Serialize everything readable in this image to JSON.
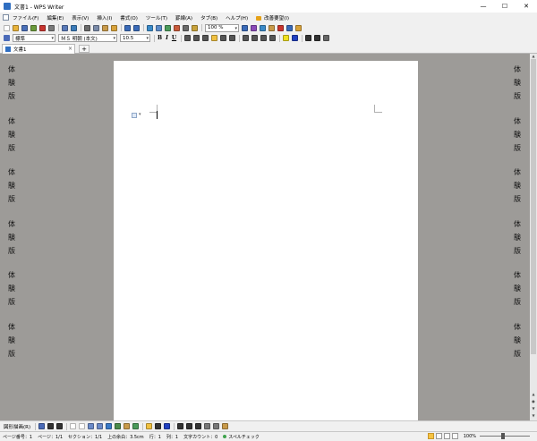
{
  "window": {
    "title": "文書1 - WPS Writer",
    "minimize": "—",
    "maximize": "☐",
    "close": "✕"
  },
  "menu": [
    "ファイル(F)",
    "編集(E)",
    "表示(V)",
    "挿入(I)",
    "書式(O)",
    "ツール(T)",
    "罫線(A)",
    "タブ(B)",
    "ヘルプ(H)",
    "改善要望(I)"
  ],
  "toolbar": {
    "zoom_value": "100 %",
    "style_value": "標準",
    "font_value": "ＭＳ 明朝 (本文)",
    "size_value": "10.5",
    "bold": "B",
    "italic": "I",
    "underline": "U",
    "icons1": [
      {
        "name": "new-icon",
        "color": "#ffffff"
      },
      {
        "name": "open-icon",
        "color": "#e8b23a"
      },
      {
        "name": "save-icon",
        "color": "#4a6fb8"
      },
      {
        "name": "email-icon",
        "color": "#6a9a3a"
      },
      {
        "name": "pdf-icon",
        "color": "#c8342e"
      },
      {
        "name": "print-icon",
        "color": "#7a7a7a"
      },
      {
        "name": "print-preview-icon",
        "color": "#5a7ab8"
      },
      {
        "name": "spellcheck-icon",
        "color": "#3a7ab8"
      },
      {
        "name": "cut-icon",
        "color": "#6a6a6a"
      },
      {
        "name": "copy-icon",
        "color": "#7a8aa8"
      },
      {
        "name": "paste-icon",
        "color": "#c89a4a"
      },
      {
        "name": "format-painter-icon",
        "color": "#d8a23a"
      },
      {
        "name": "undo-icon",
        "color": "#3a6ab8"
      },
      {
        "name": "redo-icon",
        "color": "#3a6ab8"
      },
      {
        "name": "hyperlink-icon",
        "color": "#3a8ac8"
      },
      {
        "name": "table-icon",
        "color": "#5a8ac8"
      },
      {
        "name": "picture-icon",
        "color": "#4a9a5a"
      },
      {
        "name": "chart-icon",
        "color": "#c85a3a"
      },
      {
        "name": "columns-icon",
        "color": "#6a6a6a"
      },
      {
        "name": "drawing-icon",
        "color": "#c8a23a"
      }
    ],
    "icons1_tail": [
      {
        "name": "find-icon",
        "color": "#3a6ab8"
      },
      {
        "name": "symbol-icon",
        "color": "#8a4ab8"
      },
      {
        "name": "book-icon",
        "color": "#3a8ac8"
      },
      {
        "name": "hand-icon",
        "color": "#c89a4a"
      },
      {
        "name": "gift-icon",
        "color": "#c8342e"
      },
      {
        "name": "help-icon",
        "color": "#3a6ab8"
      },
      {
        "name": "tools-icon",
        "color": "#d8a23a"
      }
    ],
    "icons2": [
      {
        "name": "align-left-icon",
        "color": "#555555"
      },
      {
        "name": "align-center-icon",
        "color": "#555555"
      },
      {
        "name": "align-right-icon",
        "color": "#555555"
      },
      {
        "name": "justify-icon",
        "color": "#f0c040"
      },
      {
        "name": "distribute-icon",
        "color": "#555555"
      },
      {
        "name": "line-spacing-icon",
        "color": "#555555"
      },
      {
        "name": "numbering-icon",
        "color": "#555555"
      },
      {
        "name": "bullets-icon",
        "color": "#555555"
      },
      {
        "name": "decrease-indent-icon",
        "color": "#555555"
      },
      {
        "name": "increase-indent-icon",
        "color": "#555555"
      },
      {
        "name": "highlight-icon",
        "color": "#f0e020"
      },
      {
        "name": "font-color-icon",
        "color": "#2040c0"
      },
      {
        "name": "grow-font-icon",
        "color": "#333333"
      },
      {
        "name": "shrink-font-icon",
        "color": "#333333"
      },
      {
        "name": "clear-format-icon",
        "color": "#666666"
      }
    ]
  },
  "tab": {
    "label": "文書1",
    "close": "×",
    "add": "+"
  },
  "watermark": {
    "chars": [
      "体",
      "験",
      "版"
    ],
    "groups": 6
  },
  "drawbar": {
    "label": "図形描画(R)",
    "icons": [
      {
        "name": "select-objects-icon",
        "color": "#4a6ab8"
      },
      {
        "name": "line-icon",
        "color": "#333333"
      },
      {
        "name": "arrow-icon",
        "color": "#333333"
      },
      {
        "name": "rectangle-icon",
        "color": "#ffffff"
      },
      {
        "name": "oval-icon",
        "color": "#ffffff"
      },
      {
        "name": "textbox-icon",
        "color": "#6a8ac8"
      },
      {
        "name": "vertical-textbox-icon",
        "color": "#6a8ac8"
      },
      {
        "name": "wordart-icon",
        "color": "#3a7ac8"
      },
      {
        "name": "diagram-icon",
        "color": "#4a8a4a"
      },
      {
        "name": "clipart-icon",
        "color": "#c89a4a"
      },
      {
        "name": "insert-picture-icon",
        "color": "#4a9a5a"
      },
      {
        "name": "fill-color-icon",
        "color": "#f0c040"
      },
      {
        "name": "line-color-icon",
        "color": "#333333"
      },
      {
        "name": "font-color-icon",
        "color": "#2040c0"
      },
      {
        "name": "line-style-icon",
        "color": "#333333"
      },
      {
        "name": "dash-style-icon",
        "color": "#333333"
      },
      {
        "name": "arrow-style-icon",
        "color": "#333333"
      },
      {
        "name": "shadow-icon",
        "color": "#777777"
      },
      {
        "name": "3d-icon",
        "color": "#777777"
      },
      {
        "name": "arrange-icon",
        "color": "#c89a4a"
      }
    ]
  },
  "status": {
    "page_number": "ページ番号：1",
    "pages": "ページ：1/1",
    "section": "セクション：1/1",
    "position": "上の余白：3.5cm",
    "line": "行：1",
    "column": "列：1",
    "word_count": "文字カウント：0",
    "spellcheck": "スペルチェック",
    "zoom": "100%"
  }
}
